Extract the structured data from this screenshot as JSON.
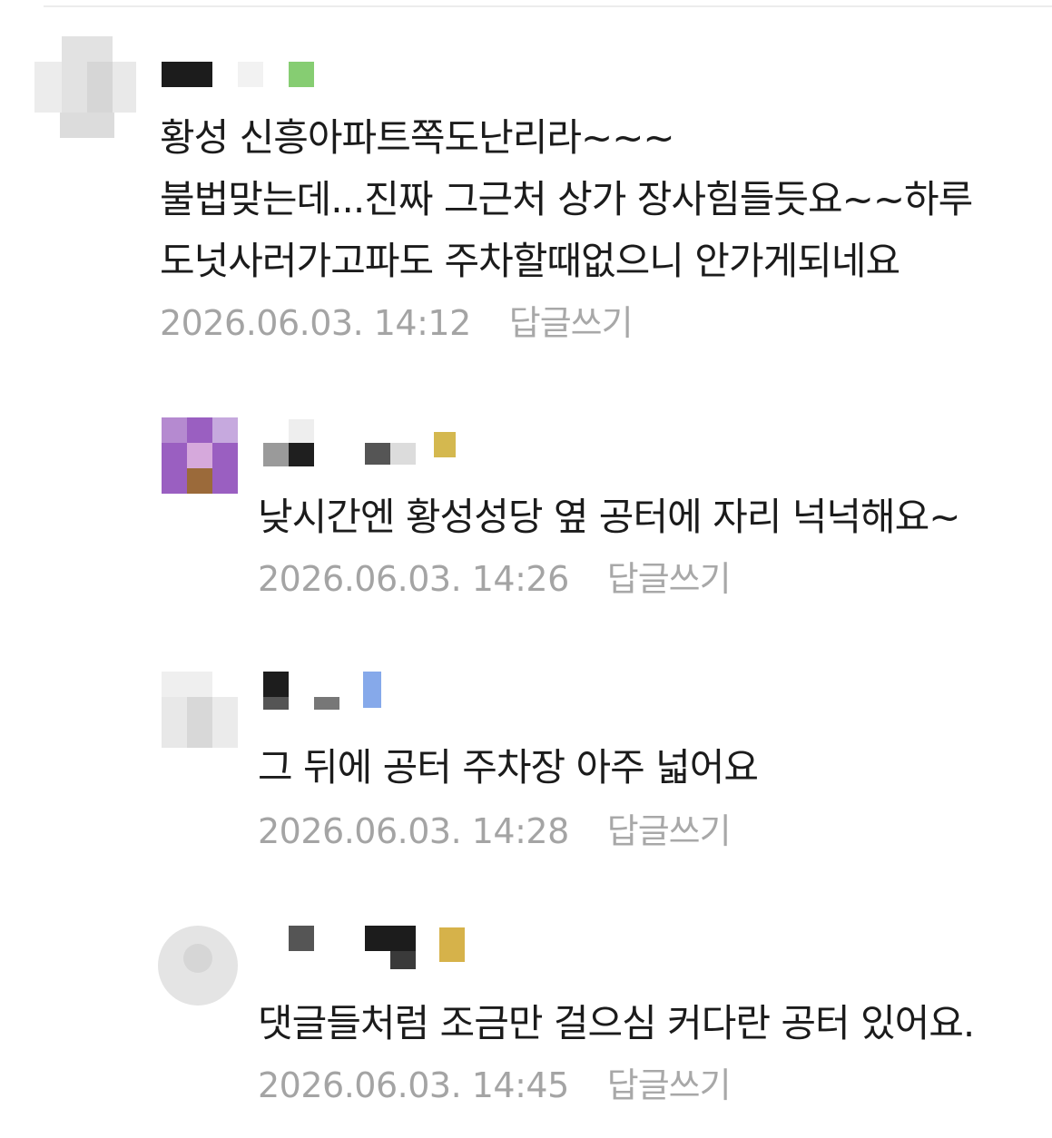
{
  "comments": [
    {
      "body": [
        "황성 신흥아파트쪽도난리라~~~",
        "불법맞는데...진짜 그근처 상가 장사힘들듯요~~하루",
        "도넛사러가고파도 주차할때없으니 안가게되네요"
      ],
      "date": "2026.06.03. 14:12",
      "reply_label": "답글쓰기",
      "badge_color": "#86cd72"
    },
    {
      "body": [
        "낮시간엔 황성성당 옆 공터에 자리 넉넉해요~"
      ],
      "date": "2026.06.03. 14:26",
      "reply_label": "답글쓰기",
      "badge_color": "#d4b84f"
    },
    {
      "body": [
        "그 뒤에 공터 주차장 아주 넓어요"
      ],
      "date": "2026.06.03. 14:28",
      "reply_label": "답글쓰기",
      "badge_color": "#86a9ea"
    },
    {
      "body": [
        "댓글들처럼 조금만 걸으심 커다란 공터 있어요."
      ],
      "date": "2026.06.03. 14:45",
      "reply_label": "답글쓰기",
      "badge_color": "#d6b24a"
    }
  ]
}
